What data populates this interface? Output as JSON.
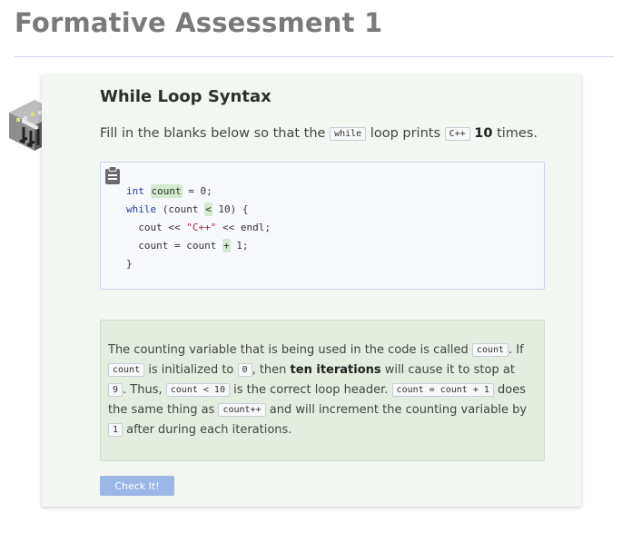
{
  "page": {
    "title": "Formative Assessment 1"
  },
  "card": {
    "title": "While Loop Syntax",
    "prompt": {
      "text_1": "Fill in the blanks below so that the",
      "code_1": "while",
      "text_2": "loop prints",
      "code_2": "C++",
      "bold": "10",
      "text_3": "times."
    },
    "code": {
      "line1": {
        "kw": "int",
        "blank": "count",
        "rest": " = 0;"
      },
      "line2": {
        "kw": "while",
        "pre": " (count ",
        "blank": "<",
        "post": " 10) {"
      },
      "line3": {
        "pre": "  cout << ",
        "str": "\"C++\"",
        "post": " << endl;"
      },
      "line4": {
        "pre": "  count = count ",
        "blank": "+",
        "post": " 1;"
      },
      "line5": "}"
    },
    "explanation": {
      "t1": "The counting variable that is being used in the code is called",
      "c1": "count",
      "t2": ". If",
      "c2": "count",
      "t3": "is initialized to",
      "c3": "0",
      "t4": ", then",
      "b1": "ten iterations",
      "t5": "will cause it to stop at",
      "c4": "9",
      "t6": ". Thus,",
      "c5": "count < 10",
      "t7": "is the correct loop header.",
      "c6": "count = count + 1",
      "t8": "does the same thing as",
      "c7": "count++",
      "t9": "and will increment the counting variable by",
      "c8": "1",
      "t10": "after during each iterations."
    },
    "check_button": "Check It!"
  },
  "icons": {
    "cube": "cube-illustration-icon",
    "clipboard": "clipboard-icon"
  }
}
